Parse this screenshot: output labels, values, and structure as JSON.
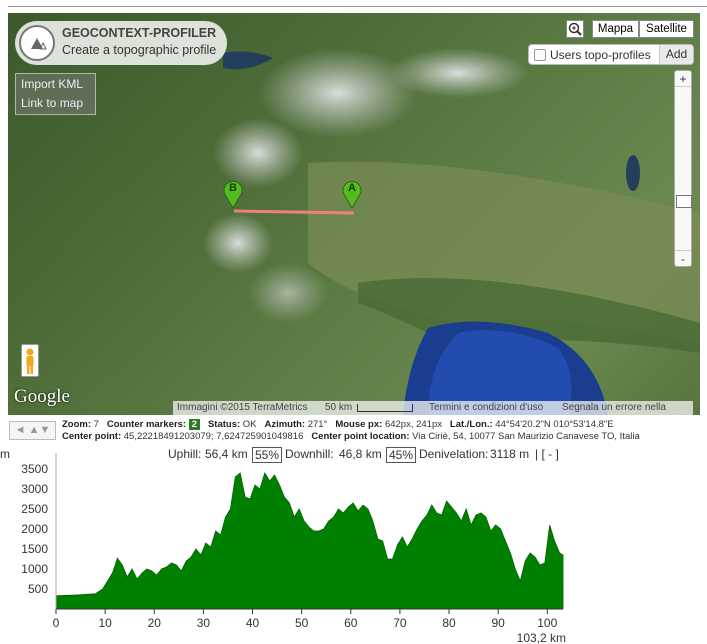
{
  "app": {
    "title": "GEOCONTEXT-PROFILER",
    "subtitle": "Create a topographic profile"
  },
  "side_links": [
    "Import KML",
    "Link to map"
  ],
  "map_type": {
    "map": "Mappa",
    "satellite": "Satellite"
  },
  "users_profiles": {
    "label": "Users topo-profiles",
    "add": "Add"
  },
  "zoom_controls": {
    "plus": "+",
    "minus": "-"
  },
  "google_logo": "Google",
  "attribution": {
    "imagery": "Immagini ©2015 TerraMetrics",
    "scale": "50 km",
    "terms": "Termini e condizioni d'uso",
    "report": "Segnala un errore nella mappa"
  },
  "markers": {
    "a": "A",
    "b": "B"
  },
  "colors": {
    "profile_fill": "#008000",
    "route_line": "#f08080",
    "marker": "#55bb22",
    "badge": "#2a7a2a"
  },
  "icons": [
    "zoom-magnifier-icon",
    "pegman-icon",
    "nav-arrows-icon"
  ],
  "info": {
    "nav": "◄ ▲▼",
    "zoom_label": "Zoom:",
    "zoom_value": "7",
    "counter_label": "Counter markers:",
    "counter_value": "2",
    "status_label": "Status:",
    "status_value": "OK",
    "azimuth_label": "Azimuth:",
    "azimuth_value": "271°",
    "mouse_label": "Mouse px:",
    "mouse_value": "642px, 241px",
    "latlon_label": "Lat./Lon.:",
    "latlon_value": "44°54'20.2\"N 010°53'14.8\"E",
    "center_label": "Center point:",
    "center_value": "45,22218491203079; 7,624725901049816",
    "location_label": "Center point location:",
    "location_value": "Via Ciriè, 54, 10077 San Maurizio Canavese TO, Italia"
  },
  "profile_header": {
    "uphill_label": "Uphill:",
    "uphill_value": "56,4 km",
    "uphill_pct": "55%",
    "downhill_label": "Downhill:",
    "downhill_value": "46,8 km",
    "downhill_pct": "45%",
    "deniv_label": "Denivelation:",
    "deniv_value": "3118 m",
    "tail": "| [ - ]"
  },
  "chart_data": {
    "type": "area",
    "title": "",
    "xlabel": "103,2 km",
    "ylabel": "m",
    "xlim": [
      0,
      103.2
    ],
    "ylim": [
      0,
      3700
    ],
    "x_ticks": [
      0,
      10,
      20,
      30,
      40,
      50,
      60,
      70,
      80,
      90,
      100
    ],
    "y_ticks": [
      500,
      1000,
      1500,
      2000,
      2500,
      3000,
      3500
    ],
    "series": [
      {
        "x": [
          0,
          4,
          8,
          9.5,
          10.5,
          11.5,
          12.5,
          13.5,
          14.5,
          15.5,
          16.5,
          17.5,
          18.5,
          19.5,
          20.5,
          21.5,
          22.5,
          23.5,
          24.5,
          25.5,
          26.5,
          27.5,
          28.5,
          29.5,
          30.5,
          31.5,
          32.5,
          33.5,
          34.5,
          35.5,
          36.5,
          37.5,
          38.5,
          39.5,
          40.5,
          41.5,
          42.5,
          43.5,
          44.5,
          45.5,
          46.5,
          47.5,
          48.5,
          49.5,
          50.5,
          51.5,
          52.5,
          53.5,
          54.5,
          55.5,
          56.5,
          57.5,
          58.5,
          59.5,
          60.5,
          61.5,
          62.5,
          63.5,
          64.5,
          65.5,
          66.5,
          67.5,
          68.5,
          69.5,
          70.5,
          71.5,
          72.5,
          73.5,
          74.5,
          75.5,
          76.5,
          77.5,
          78.5,
          79.5,
          80.5,
          81.5,
          82.5,
          83.5,
          84.5,
          85.5,
          86.5,
          87.5,
          88.5,
          89.5,
          90.5,
          91.5,
          92.5,
          93.5,
          94.5,
          95.5,
          96.5,
          97.5,
          98.5,
          99.5,
          100.5,
          101.5,
          102.5,
          103.2
        ],
        "y": [
          330,
          350,
          380,
          500,
          700,
          900,
          1270,
          1100,
          800,
          1000,
          750,
          900,
          1000,
          950,
          850,
          1000,
          1050,
          1150,
          1100,
          950,
          1200,
          1300,
          1500,
          1350,
          1650,
          1550,
          1950,
          1850,
          2300,
          2500,
          3300,
          3400,
          2800,
          2750,
          3100,
          3000,
          3400,
          3200,
          3350,
          3100,
          2800,
          2650,
          2300,
          2500,
          2200,
          2050,
          1950,
          1950,
          2000,
          2200,
          2300,
          2500,
          2400,
          2550,
          2650,
          2450,
          2600,
          2500,
          2200,
          1750,
          1700,
          1250,
          1250,
          1600,
          1800,
          1550,
          1750,
          2000,
          2200,
          2350,
          2600,
          2400,
          2350,
          2700,
          2550,
          2400,
          2200,
          2500,
          2100,
          2350,
          2400,
          2300,
          1950,
          2100,
          2000,
          1700,
          1400,
          1000,
          700,
          1200,
          1400,
          1300,
          1100,
          1150,
          2100,
          1700,
          1400,
          1350
        ]
      }
    ]
  }
}
